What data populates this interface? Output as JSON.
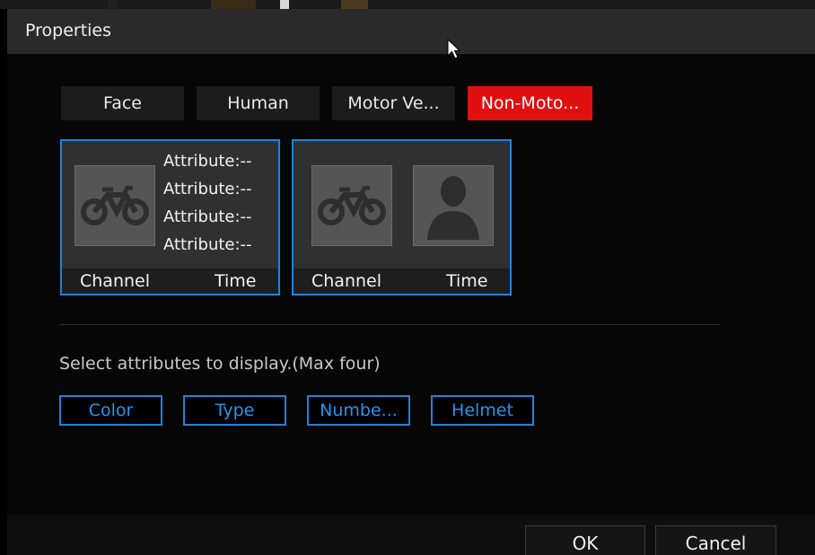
{
  "dialog": {
    "title": "Properties"
  },
  "tabs": [
    {
      "label": "Face",
      "active": false
    },
    {
      "label": "Human",
      "active": false
    },
    {
      "label": "Motor Ve...",
      "active": false
    },
    {
      "label": "Non-Moto...",
      "active": true
    }
  ],
  "cards": [
    {
      "attributes": [
        "Attribute:--",
        "Attribute:--",
        "Attribute:--",
        "Attribute:--"
      ],
      "footer_left": "Channel",
      "footer_right": "Time"
    },
    {
      "footer_left": "Channel",
      "footer_right": "Time"
    }
  ],
  "hint": "Select attributes to display.(Max four)",
  "attribute_buttons": [
    "Color",
    "Type",
    "Numbe...",
    "Helmet"
  ],
  "buttons": {
    "ok": "OK",
    "cancel": "Cancel"
  },
  "colors": {
    "accent": "#1a84e0",
    "active_tab": "#e01010",
    "background": "#060606"
  },
  "icons": [
    "bicycle-icon",
    "person-icon",
    "cursor-icon"
  ]
}
